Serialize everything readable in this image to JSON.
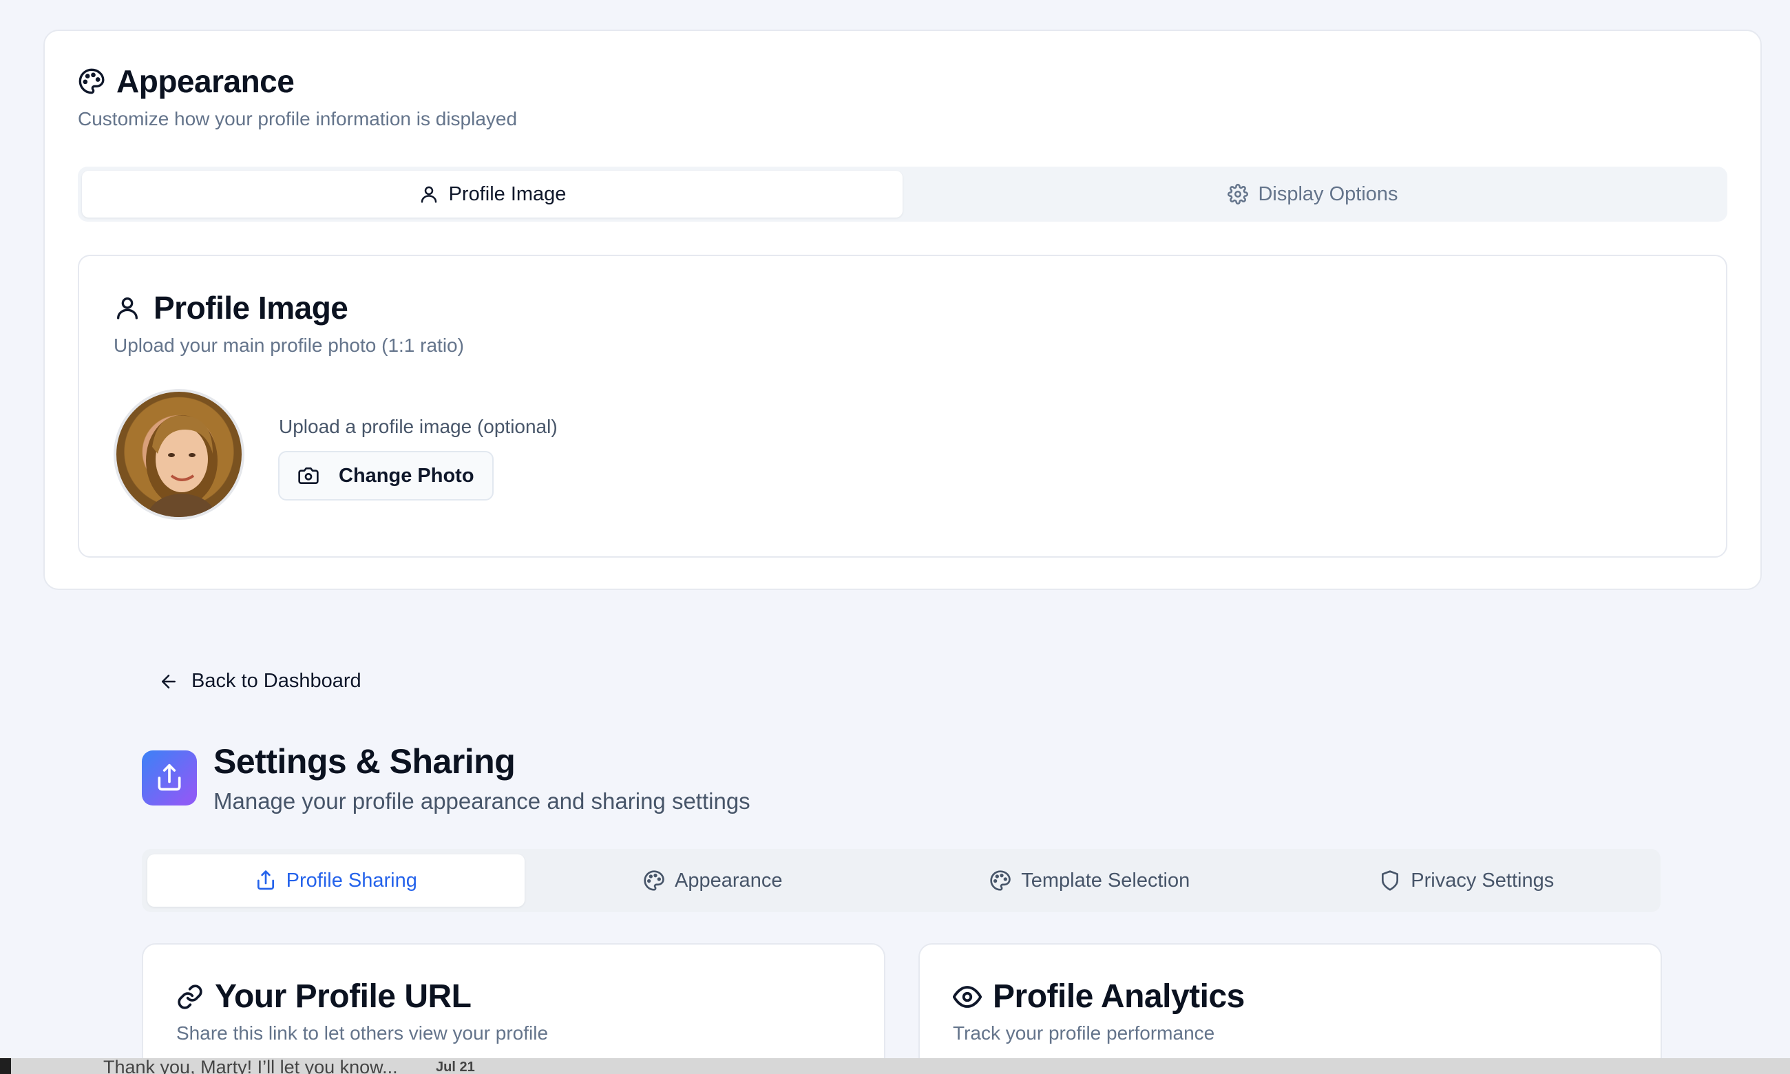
{
  "appearance": {
    "title": "Appearance",
    "subtitle": "Customize how your profile information is displayed",
    "tabs": [
      {
        "label": "Profile Image",
        "icon": "user-icon",
        "active": true
      },
      {
        "label": "Display Options",
        "icon": "gear-icon",
        "active": false
      }
    ],
    "profile_image": {
      "title": "Profile Image",
      "subtitle": "Upload your main profile photo (1:1 ratio)",
      "upload_label": "Upload a profile image (optional)",
      "change_button": "Change Photo"
    }
  },
  "navigation": {
    "back_label": "Back to Dashboard"
  },
  "header": {
    "title": "Settings & Sharing",
    "subtitle": "Manage your profile appearance and sharing settings",
    "icon_gradient": [
      "#3b82f6",
      "#8b5cf6"
    ]
  },
  "main_tabs": [
    {
      "label": "Profile Sharing",
      "icon": "share-icon",
      "active": true
    },
    {
      "label": "Appearance",
      "icon": "palette-icon",
      "active": false
    },
    {
      "label": "Template Selection",
      "icon": "palette-icon",
      "active": false
    },
    {
      "label": "Privacy Settings",
      "icon": "shield-icon",
      "active": false
    }
  ],
  "cards": {
    "profile_url": {
      "title": "Your Profile URL",
      "subtitle": "Share this link to let others view your profile"
    },
    "analytics": {
      "title": "Profile Analytics",
      "subtitle": "Track your profile performance"
    }
  },
  "chat_preview": {
    "message": "Thank you, Marty! I’ll let you know...",
    "date": "Jul 21"
  },
  "colors": {
    "accent": "#2563eb",
    "background": "#f3f5fb",
    "card": "#ffffff",
    "muted_text": "#64748b"
  }
}
